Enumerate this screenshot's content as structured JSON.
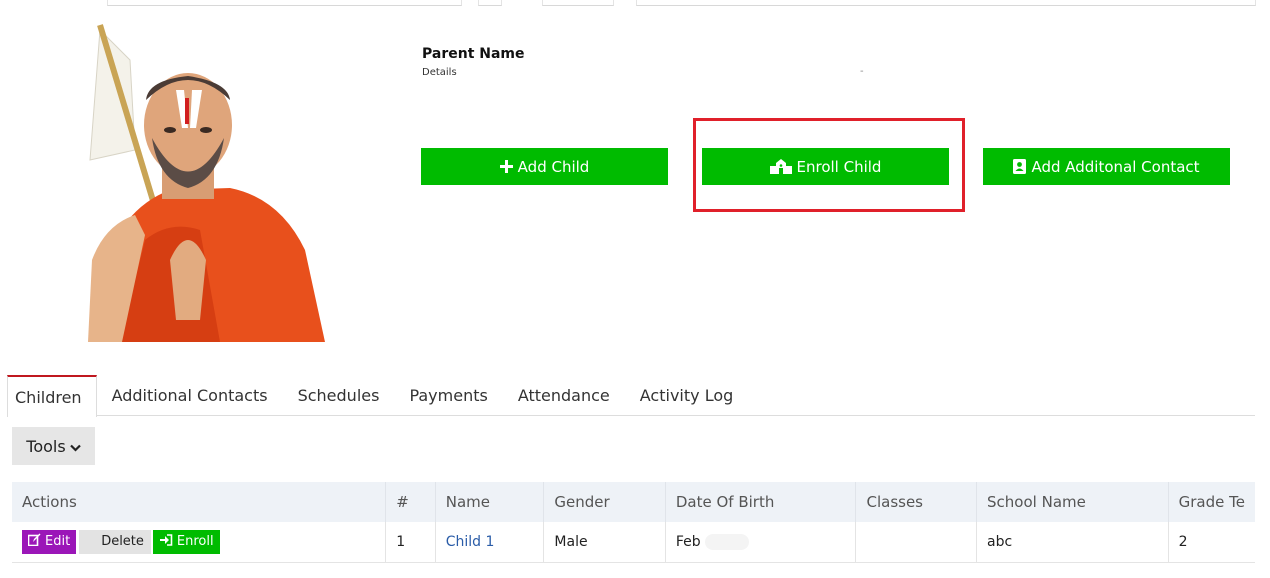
{
  "parent": {
    "name": "Parent Name",
    "details": "Details",
    "dash": "-"
  },
  "actions": {
    "add_child": "Add Child",
    "enroll_child": "Enroll Child",
    "add_contact": "Add Additonal Contact"
  },
  "tabs": [
    {
      "label": "Children",
      "active": true
    },
    {
      "label": "Additional Contacts"
    },
    {
      "label": "Schedules"
    },
    {
      "label": "Payments"
    },
    {
      "label": "Attendance"
    },
    {
      "label": "Activity Log"
    }
  ],
  "tools": {
    "label": "Tools"
  },
  "table": {
    "headers": [
      "Actions",
      "#",
      "Name",
      "Gender",
      "Date Of Birth",
      "Classes",
      "School Name",
      "Grade Te"
    ],
    "row_actions": {
      "edit": "Edit",
      "delete": "Delete",
      "enroll": "Enroll"
    },
    "rows": [
      {
        "num": "1",
        "name": "Child 1",
        "gender": "Male",
        "dob": "Feb",
        "classes": "",
        "school": "abc",
        "grade": "2"
      }
    ]
  },
  "colors": {
    "accent_green": "#00bb00",
    "highlight_red": "#e0202a",
    "edit_purple": "#9b16b8",
    "tab_active": "#c0181f"
  }
}
